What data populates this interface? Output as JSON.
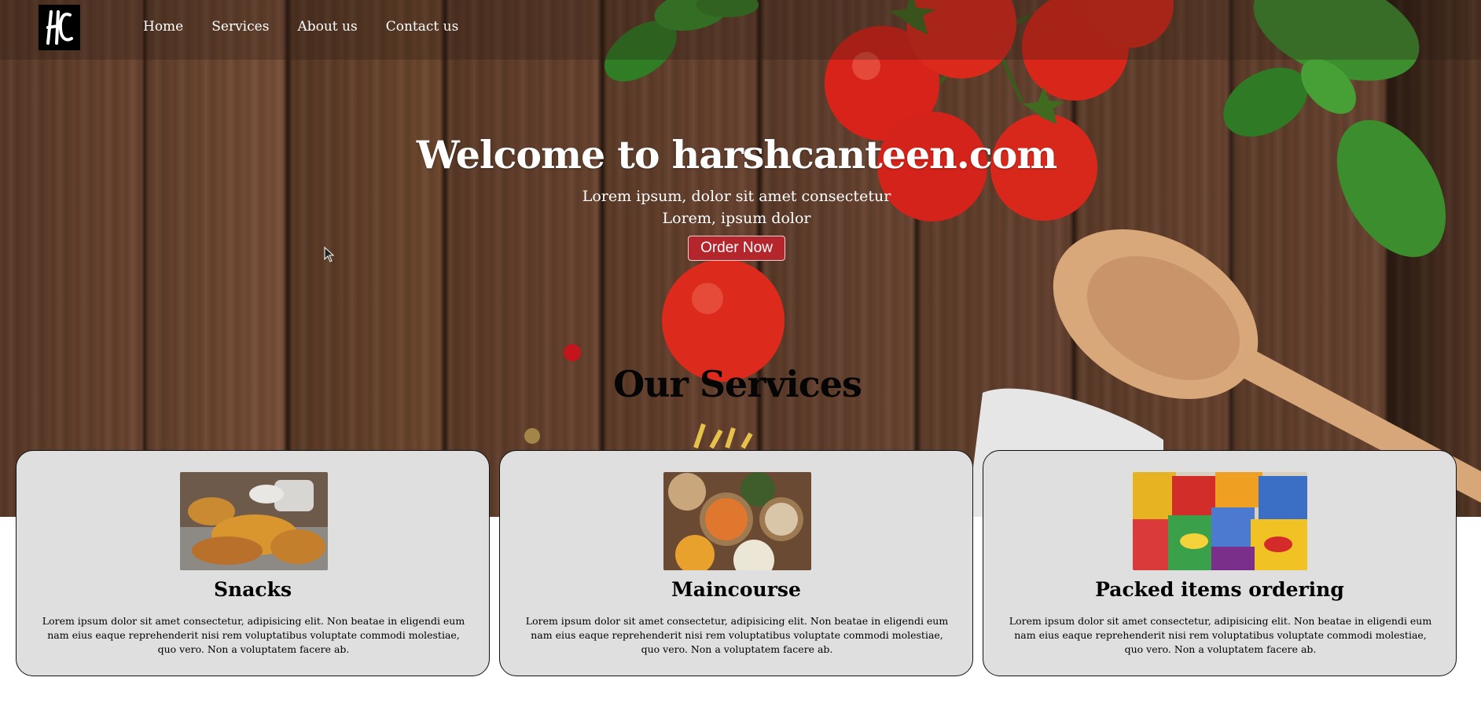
{
  "brand": {
    "logo_text": "HC"
  },
  "nav": {
    "items": [
      {
        "label": "Home"
      },
      {
        "label": "Services"
      },
      {
        "label": "About us"
      },
      {
        "label": "Contact us"
      }
    ]
  },
  "hero": {
    "title": "Welcome to harshcanteen.com",
    "line1": "Lorem ipsum, dolor sit amet consectetur",
    "line2": "Lorem, ipsum dolor",
    "cta_label": "Order Now"
  },
  "services": {
    "heading": "Our Services",
    "cards": [
      {
        "title": "Snacks",
        "image": "fried-snacks-photo",
        "text": "Lorem ipsum dolor sit amet consectetur, adipisicing elit. Non beatae in eligendi eum nam eius eaque reprehenderit nisi rem voluptatibus voluptate commodi molestiae, quo vero. Non a voluptatem facere ab."
      },
      {
        "title": "Maincourse",
        "image": "indian-curry-photo",
        "text": "Lorem ipsum dolor sit amet consectetur, adipisicing elit. Non beatae in eligendi eum nam eius eaque reprehenderit nisi rem voluptatibus voluptate commodi molestiae, quo vero. Non a voluptatem facere ab."
      },
      {
        "title": "Packed items ordering",
        "image": "packed-chips-photo",
        "text": "Lorem ipsum dolor sit amet consectetur, adipisicing elit. Non beatae in eligendi eum nam eius eaque reprehenderit nisi rem voluptatibus voluptate commodi molestiae, quo vero. Non a voluptatem facere ab."
      }
    ]
  },
  "colors": {
    "cta_background": "#b5262c",
    "card_background": "#e0dfdf",
    "nav_text": "#ffffff",
    "wood_dark": "#5a3a28"
  }
}
